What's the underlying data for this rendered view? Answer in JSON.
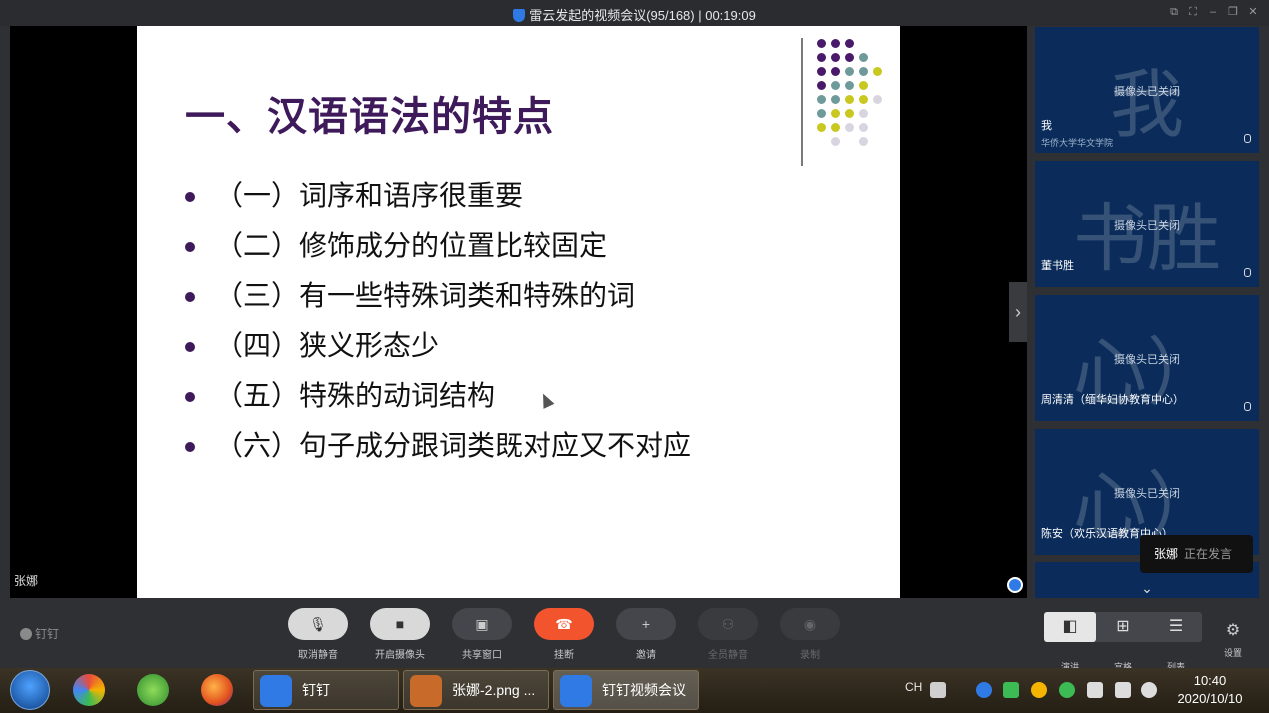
{
  "window": {
    "title": "雷云发起的视频会议(95/168)  |  00:19:09",
    "controls": [
      "⧉",
      "⛶",
      "–",
      "❐",
      "✕"
    ]
  },
  "slide": {
    "title": "一、汉语语法的特点",
    "bullets": [
      "（一）词序和语序很重要",
      "（二）修饰成分的位置比较固定",
      "（三）有一些特殊词类和特殊的词",
      "（四）狭义形态少",
      "（五）特殊的动词结构",
      "（六）句子成分跟词类既对应又不对应"
    ],
    "colors": {
      "title": "#3e1a5a",
      "dot_purple": "#4a1a6a",
      "dot_teal": "#6f9a9a",
      "dot_yellow": "#c8c820",
      "dot_light": "#d8d4e0"
    }
  },
  "stage": {
    "speaker_label": "张娜",
    "next_icon": "chevron-right-icon"
  },
  "participants": [
    {
      "glyph": "我",
      "camera_status": "摄像头已关闭",
      "name": "我",
      "org": "华侨大学华文学院"
    },
    {
      "glyph": "书胜",
      "camera_status": "摄像头已关闭",
      "name": "董书胜",
      "org": ""
    },
    {
      "glyph": "心）",
      "camera_status": "摄像头已关闭",
      "name": "周清清（缅华妇协教育中心）",
      "org": ""
    },
    {
      "glyph": "心）",
      "camera_status": "摄像头已关闭",
      "name": "陈安（欢乐汉语教育中心）",
      "org": ""
    }
  ],
  "speaking_toast": {
    "name": "张娜",
    "status": "正在发言"
  },
  "toolbar": {
    "brand": "钉钉",
    "buttons": [
      {
        "label": "取消静音",
        "icon": "mic-icon",
        "glyph": "🎙"
      },
      {
        "label": "开启摄像头",
        "icon": "camera-off-icon",
        "glyph": "■"
      },
      {
        "label": "共享窗口",
        "icon": "share-window-icon",
        "glyph": "▣"
      },
      {
        "label": "挂断",
        "icon": "hangup-icon",
        "glyph": "☎"
      },
      {
        "label": "邀请",
        "icon": "invite-icon",
        "glyph": "+"
      },
      {
        "label": "全员静音",
        "icon": "mute-all-icon",
        "glyph": "⚇"
      },
      {
        "label": "录制",
        "icon": "record-icon",
        "glyph": "◉"
      }
    ],
    "layouts": [
      {
        "label": "演讲",
        "glyph": "◧"
      },
      {
        "label": "宫格",
        "glyph": "⊞"
      },
      {
        "label": "列表",
        "glyph": "☰"
      }
    ],
    "settings_label": "设置"
  },
  "taskbar": {
    "items": [
      {
        "label": "钉钉",
        "color": "#2f7ae5"
      },
      {
        "label": "张娜-2.png ...",
        "color": "#c76a2a"
      },
      {
        "label": "钉钉视频会议",
        "color": "#2f7ae5"
      }
    ],
    "tray_lang": "CH",
    "time": "10:40",
    "date": "2020/10/10"
  }
}
